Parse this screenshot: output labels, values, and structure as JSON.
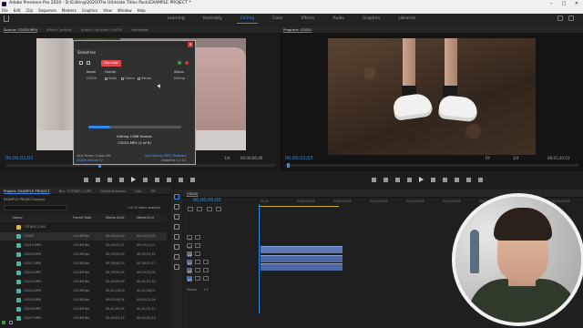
{
  "titlebar": {
    "title": "Adobe Premiere Pro 2020 - D:\\Editing\\2020\\The Ultimate Titles Pack\\EXAMPLE PROJECT *",
    "minimize": "–",
    "maximize": "□",
    "close": "✕"
  },
  "menu": [
    "File",
    "Edit",
    "Clip",
    "Sequence",
    "Markers",
    "Graphics",
    "View",
    "Window",
    "Help"
  ],
  "workspaces": [
    {
      "label": "Learning",
      "active": false
    },
    {
      "label": "Assembly",
      "active": false
    },
    {
      "label": "Editing",
      "active": true
    },
    {
      "label": "Color",
      "active": false
    },
    {
      "label": "Effects",
      "active": false
    },
    {
      "label": "Audio",
      "active": false
    },
    {
      "label": "Graphics",
      "active": false
    },
    {
      "label": "Libraries",
      "active": false
    }
  ],
  "source": {
    "tabs": [
      "Source: C0020.MP4",
      "Effect Controls",
      "Audio Clip Mixer: C0020",
      "Metadata"
    ],
    "timecode_left": "00;00;02;01",
    "timecode_right": "00;00;00;46",
    "zoom": "1/4"
  },
  "program": {
    "tab": "Program: C0020",
    "timecode_left": "00;00;02;03",
    "fit": "Fit",
    "zoom": "1/4",
    "timecode_right": "00;01;20;01"
  },
  "dialog": {
    "tab": "Shakefree",
    "run_label": "Run now",
    "col_name": "Name",
    "col_format": "Format",
    "col_status": "Status",
    "row_name": "C0020",
    "opt_1": "Scale",
    "opt_2": "Frame",
    "opt_3": "Rotate",
    "row_status": "Editing",
    "progress": 0.24,
    "status_line_1": "Editing 1366 frames",
    "status_line_2": "C0022.MP4 (2 of 6)",
    "foot_left_1": "Total Period: 0 days left",
    "foot_left_2": "2020/9 Version v2",
    "foot_right_1": "User Manual (PDF) Feedback",
    "foot_right_2": "shakefree 1.2.12"
  },
  "project": {
    "tabs": [
      "Project: EXAMPLE PROJECT",
      "Bin: TOTNES CLIPS",
      "Media Browser",
      "Info",
      "Eff"
    ],
    "path": "EXAMPLE PROJECT.prproj",
    "items_label": "1 of 12 items selected",
    "col_name": "Name",
    "col_fr": "Frame Rate",
    "col_ms": "Media Start",
    "col_me": "Media End",
    "rows": [
      {
        "name": "TOTNES CLIPS",
        "fr": "",
        "ms": "",
        "me": "",
        "folder": true
      },
      {
        "name": "C0020",
        "fr": "119.88 fps",
        "ms": "00;00;00;00",
        "me": "00;14;21;02",
        "folder": false
      },
      {
        "name": "C0019.MP4",
        "fr": "119.88 fps",
        "ms": "00;29;02;07",
        "me": "00;29;12;21",
        "folder": false
      },
      {
        "name": "C0020.MP4",
        "fr": "119.88 fps",
        "ms": "00;29;50;05",
        "me": "00;29;55;12",
        "folder": false
      },
      {
        "name": "C0021.MP4",
        "fr": "119.88 fps",
        "ms": "00;36;44;25",
        "me": "00;36;47;17",
        "folder": false
      },
      {
        "name": "C0022.MP4",
        "fr": "119.88 fps",
        "ms": "00;29;50;05",
        "me": "00;29;55;05",
        "folder": false
      },
      {
        "name": "C0023.MP4",
        "fr": "119.88 fps",
        "ms": "00;40;00;00",
        "me": "00;40;57;10",
        "folder": false
      },
      {
        "name": "C0024.MP4",
        "fr": "119.88 fps",
        "ms": "00;41;14;03",
        "me": "00;41;18;01",
        "folder": false
      },
      {
        "name": "C0025.MP4",
        "fr": "119.88 fps",
        "ms": "00;43;09;04",
        "me": "00;43;12;16",
        "folder": false
      },
      {
        "name": "C0026.MP4",
        "fr": "119.88 fps",
        "ms": "00;41;09;24",
        "me": "00;41;12;11",
        "folder": false
      },
      {
        "name": "C0027.MP4",
        "fr": "119.88 fps",
        "ms": "00;44;03;15",
        "me": "00;44;10;23",
        "folder": false
      }
    ]
  },
  "timeline": {
    "tab": "C0020",
    "timecode": "00;00;00;00",
    "ruler": [
      "00;00",
      "00;00;29;29",
      "00;00;59;28",
      "00;01;29;29",
      "00;01;59;28",
      "00;02;29;29",
      "00;02;59;28",
      "00;03;29;29",
      "00;03;59;28"
    ],
    "video_tracks": [
      "V3",
      "V2",
      "V1"
    ],
    "audio_tracks": [
      "A1",
      "A2",
      "A3"
    ],
    "master_label": "Master",
    "master_value": "0.0"
  },
  "colors": {
    "accent": "#2d8ceb",
    "clip": "#5e78b5",
    "run_button": "#e5484d",
    "project_icon": "#4db2a7"
  }
}
